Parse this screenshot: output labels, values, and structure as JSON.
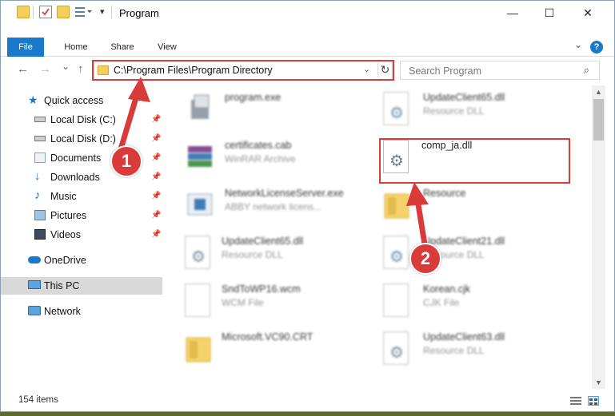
{
  "window": {
    "title": "Program",
    "controls": {
      "minimize": "—",
      "maximize": "☐",
      "close": "✕"
    }
  },
  "ribbon": {
    "tabs": [
      "File",
      "Home",
      "Share",
      "View"
    ],
    "help": "?"
  },
  "nav": {
    "back": "←",
    "forward": "→",
    "recent": "⌄",
    "up": "↑",
    "address": "C:\\Program Files\\Program Directory",
    "search_placeholder": "Search Program"
  },
  "sidebar": {
    "items": [
      {
        "label": "Quick access",
        "icon": "star-icon",
        "pinned": false
      },
      {
        "label": "Local Disk (C:)",
        "icon": "drive-icon",
        "pinned": true
      },
      {
        "label": "Local Disk (D:)",
        "icon": "drive-icon",
        "pinned": true
      },
      {
        "label": "Documents",
        "icon": "documents-icon",
        "pinned": true
      },
      {
        "label": "Downloads",
        "icon": "download-icon",
        "pinned": true
      },
      {
        "label": "Music",
        "icon": "music-icon",
        "pinned": true
      },
      {
        "label": "Pictures",
        "icon": "pictures-icon",
        "pinned": true
      },
      {
        "label": "Videos",
        "icon": "videos-icon",
        "pinned": true
      },
      {
        "label": "OneDrive",
        "icon": "cloud-icon",
        "pinned": false
      },
      {
        "label": "This PC",
        "icon": "computer-icon",
        "pinned": false,
        "selected": true
      },
      {
        "label": "Network",
        "icon": "network-icon",
        "pinned": false
      }
    ]
  },
  "files": [
    {
      "name": "program.exe",
      "type": ""
    },
    {
      "name": "UpdateClient65.dll",
      "type": "Resource DLL"
    },
    {
      "name": "certificates.cab",
      "type": "WinRAR Archive"
    },
    {
      "name": "comp_ja.dll",
      "type": ""
    },
    {
      "name": "NetworkLicenseServer.exe",
      "type": "ABBY network licens..."
    },
    {
      "name": "Resource",
      "type": ""
    },
    {
      "name": "UpdateClient65.dll",
      "type": "Resource DLL"
    },
    {
      "name": "UpdateClient21.dll",
      "type": "Resource DLL"
    },
    {
      "name": "SndToWP16.wcm",
      "type": "WCM File"
    },
    {
      "name": "Korean.cjk",
      "type": "CJK File"
    },
    {
      "name": "Microsoft.VC90.CRT",
      "type": ""
    },
    {
      "name": "UpdateClient63.dll",
      "type": "Resource DLL"
    }
  ],
  "status": {
    "item_count": "154 items"
  },
  "annotations": {
    "badge1": "1",
    "badge2": "2"
  },
  "colors": {
    "accent": "#1979ca",
    "highlight": "#d93b3b",
    "selected_bg": "#d9d9d9"
  }
}
